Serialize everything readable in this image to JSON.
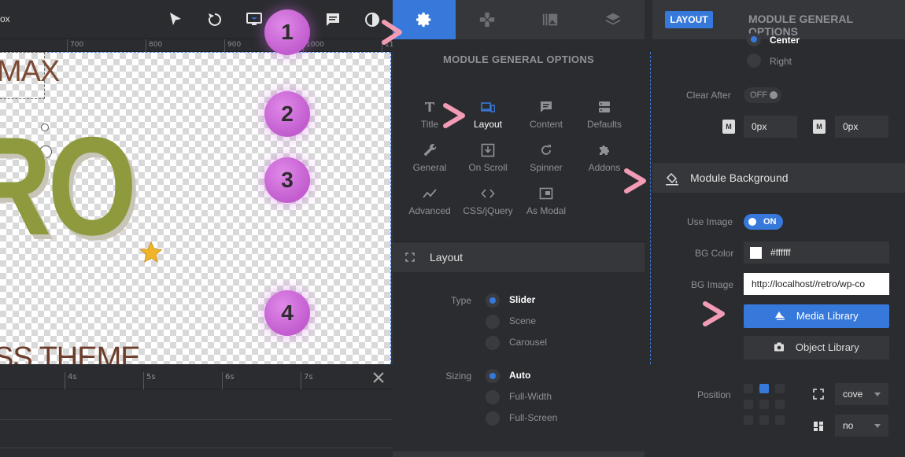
{
  "editor": {
    "box_label": "ox",
    "ruler_labels": [
      "700",
      "800",
      "900",
      "1000",
      "11"
    ],
    "slide_text_top": "MAX",
    "slide_text_main": "RO",
    "slide_text_bottom": "SS THEME",
    "timeline_labels": [
      "4s",
      "5s",
      "6s",
      "7s"
    ]
  },
  "module_panel": {
    "title": "MODULE GENERAL OPTIONS",
    "tabs": [
      "gear-icon",
      "gamepad-icon",
      "gallery-icon",
      "layers-icon"
    ],
    "option_items": [
      {
        "label": "Title",
        "icon": "title-icon"
      },
      {
        "label": "Layout",
        "icon": "devices-icon"
      },
      {
        "label": "Content",
        "icon": "comment-icon"
      },
      {
        "label": "Defaults",
        "icon": "database-icon"
      },
      {
        "label": "General",
        "icon": "wrench-icon"
      },
      {
        "label": "On Scroll",
        "icon": "download-icon"
      },
      {
        "label": "Spinner",
        "icon": "refresh-icon"
      },
      {
        "label": "Addons",
        "icon": "puzzle-icon"
      },
      {
        "label": "Advanced",
        "icon": "trend-icon"
      },
      {
        "label": "CSS/jQuery",
        "icon": "code-icon"
      },
      {
        "label": "As Modal",
        "icon": "modal-icon"
      }
    ],
    "layout_section": {
      "heading": "Layout",
      "type_label": "Type",
      "type_options": [
        "Slider",
        "Scene",
        "Carousel"
      ],
      "type_selected": "Slider",
      "sizing_label": "Sizing",
      "sizing_options": [
        "Auto",
        "Full-Width",
        "Full-Screen"
      ],
      "sizing_selected": "Auto"
    }
  },
  "settings_panel": {
    "badge": "LAYOUT",
    "title": "MODULE GENERAL OPTIONS",
    "align_options": [
      "Center",
      "Right"
    ],
    "clear_after_label": "Clear After",
    "clear_after_value": "OFF",
    "margin_badge": "M",
    "margin_left_value": "0px",
    "margin_right_value": "0px",
    "background_section": "Module Background",
    "use_image_label": "Use Image",
    "use_image_value": "ON",
    "bg_color_label": "BG Color",
    "bg_color_value": "#ffffff",
    "bg_image_label": "BG Image",
    "bg_image_value": "http://localhost//retro/wp-co",
    "media_library_label": "Media Library",
    "object_library_label": "Object Library",
    "position_label": "Position",
    "size_value": "cove",
    "repeat_value": "no"
  },
  "annotations": {
    "steps": [
      "1",
      "2",
      "3",
      "4"
    ]
  },
  "colors": {
    "accent": "#3779db",
    "bubble": "#d47ae0"
  }
}
